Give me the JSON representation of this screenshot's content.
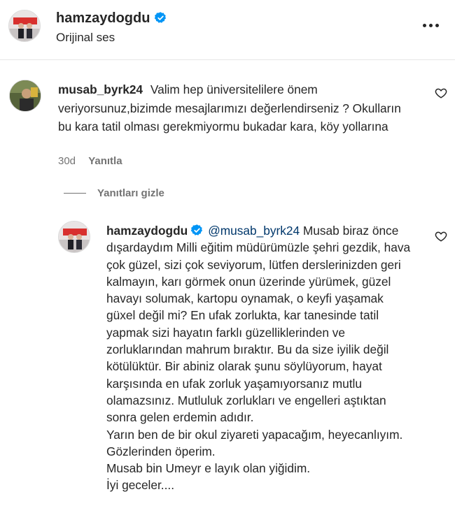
{
  "header": {
    "username": "hamzaydogdu",
    "subtitle": "Orijinal ses",
    "more_icon": "more-horizontal-icon"
  },
  "comment": {
    "username": "musab_byrk24",
    "text": "Valim hep üniversitelilere önem veriyorsunuz,bizimde mesajlarımızı değerlendirseniz ? Okulların bu kara tatil olması gerekmiyormu bukadar kara, köy yollarına",
    "time": "30d",
    "reply_label": "Yanıtla"
  },
  "hide_replies_label": "Yanıtları gizle",
  "reply": {
    "username": "hamzaydogdu",
    "mention": "@musab_byrk24",
    "lines": [
      "Musab biraz önce dışardaydım Milli eğitim müdürümüzle şehri gezdik, hava çok güzel, sizi çok seviyorum, lütfen derslerinizden geri kalmayın, karı görmek onun üzerinde yürümek, güzel havayı solumak, kartopu oynamak, o keyfi yaşamak güxel değil mi? En ufak zorlukta, kar tanesinde tatil yapmak sizi hayatın farklı güzelliklerinden ve zorluklarından mahrum bıraktır. Bu da size iyilik değil kötülüktür. Bir abiniz olarak şunu söylüyorum, hayat karşısında en ufak zorluk yaşamıyorsanız mutlu olamazsınız. Mutluluk zorlukları ve engelleri aştıktan sonra gelen erdemin adıdır.",
      "Yarın ben de bir okul ziyareti yapacağım, heyecanlıyım.",
      "Gözlerinden öperim.",
      "Musab bin Umeyr e layık olan yiğidim.",
      "İyi geceler...."
    ]
  },
  "colors": {
    "verified": "#0095f6",
    "secondary_text": "#737373",
    "link": "#00376b"
  }
}
